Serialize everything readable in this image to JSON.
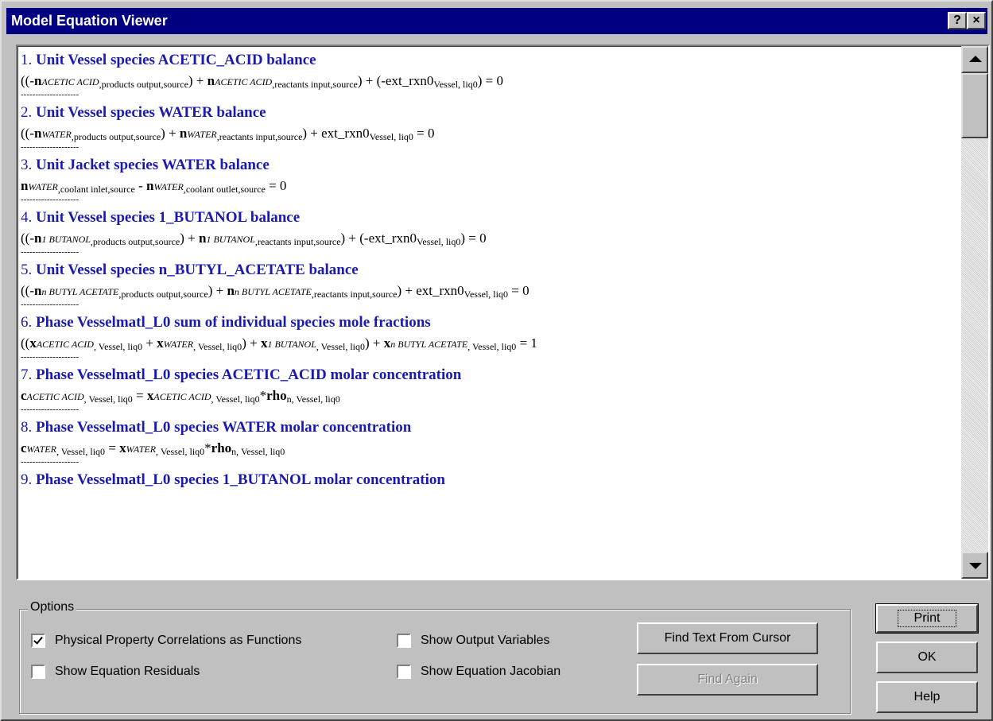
{
  "window": {
    "title": "Model Equation Viewer",
    "help_glyph": "?",
    "close_glyph": "×"
  },
  "equations": [
    {
      "num": "1.",
      "title": "Unit Vessel species ACETIC_ACID balance",
      "line": [
        {
          "t": "((-"
        },
        {
          "v": "n"
        },
        {
          "i": "ACETIC ACID"
        },
        {
          "s": ",products output,source"
        },
        {
          "t": ") + "
        },
        {
          "v": "n"
        },
        {
          "i": "ACETIC ACID"
        },
        {
          "s": ",reactants input,source"
        },
        {
          "t": ") + (-ext_rxn0"
        },
        {
          "s": "Vessel, liq0"
        },
        {
          "t": ") = 0"
        }
      ]
    },
    {
      "num": "2.",
      "title": "Unit Vessel species WATER balance",
      "line": [
        {
          "t": "((-"
        },
        {
          "v": "n"
        },
        {
          "i": "WATER"
        },
        {
          "s": ",products output,source"
        },
        {
          "t": ") + "
        },
        {
          "v": "n"
        },
        {
          "i": "WATER"
        },
        {
          "s": ",reactants input,source"
        },
        {
          "t": ") + ext_rxn0"
        },
        {
          "s": "Vessel, liq0"
        },
        {
          "t": " = 0"
        }
      ]
    },
    {
      "num": "3.",
      "title": "Unit Jacket species WATER balance",
      "line": [
        {
          "v": "n"
        },
        {
          "i": "WATER"
        },
        {
          "s": ",coolant inlet,source"
        },
        {
          "t": " - "
        },
        {
          "v": "n"
        },
        {
          "i": "WATER"
        },
        {
          "s": ",coolant outlet,source"
        },
        {
          "t": " = 0"
        }
      ]
    },
    {
      "num": "4.",
      "title": "Unit Vessel species 1_BUTANOL balance",
      "line": [
        {
          "t": "((-"
        },
        {
          "v": "n"
        },
        {
          "i": "1 BUTANOL"
        },
        {
          "s": ",products output,source"
        },
        {
          "t": ") + "
        },
        {
          "v": "n"
        },
        {
          "i": "1 BUTANOL"
        },
        {
          "s": ",reactants input,source"
        },
        {
          "t": ") + (-ext_rxn0"
        },
        {
          "s": "Vessel, liq0"
        },
        {
          "t": ") = 0"
        }
      ]
    },
    {
      "num": "5.",
      "title": "Unit Vessel species n_BUTYL_ACETATE balance",
      "line": [
        {
          "t": "((-"
        },
        {
          "v": "n"
        },
        {
          "i": "n BUTYL ACETATE"
        },
        {
          "s": ",products output,source"
        },
        {
          "t": ") + "
        },
        {
          "v": "n"
        },
        {
          "i": "n BUTYL ACETATE"
        },
        {
          "s": ",reactants input,source"
        },
        {
          "t": ") + ext_rxn0"
        },
        {
          "s": "Vessel, liq0"
        },
        {
          "t": " = 0"
        }
      ]
    },
    {
      "num": "6.",
      "title": "Phase Vesselmatl_L0 sum of individual species mole fractions",
      "line": [
        {
          "t": "(("
        },
        {
          "v": "x"
        },
        {
          "i": "ACETIC ACID"
        },
        {
          "s": ", Vessel, liq0"
        },
        {
          "t": " + "
        },
        {
          "v": "x"
        },
        {
          "i": "WATER"
        },
        {
          "s": ", Vessel, liq0"
        },
        {
          "t": ") + "
        },
        {
          "v": "x"
        },
        {
          "i": "1 BUTANOL"
        },
        {
          "s": ", Vessel, liq0"
        },
        {
          "t": ") + "
        },
        {
          "v": "x"
        },
        {
          "i": "n BUTYL ACETATE"
        },
        {
          "s": ", Vessel, liq0"
        },
        {
          "t": " = 1"
        }
      ]
    },
    {
      "num": "7.",
      "title": "Phase Vesselmatl_L0 species ACETIC_ACID molar concentration",
      "line": [
        {
          "v": "c"
        },
        {
          "i": "ACETIC ACID"
        },
        {
          "s": ", Vessel, liq0"
        },
        {
          "t": " = "
        },
        {
          "v": "x"
        },
        {
          "i": "ACETIC ACID"
        },
        {
          "s": ", Vessel, liq0"
        },
        {
          "t": "*"
        },
        {
          "v": "rho"
        },
        {
          "s": "n, Vessel, liq0"
        }
      ]
    },
    {
      "num": "8.",
      "title": "Phase Vesselmatl_L0 species WATER molar concentration",
      "line": [
        {
          "v": "c"
        },
        {
          "i": "WATER"
        },
        {
          "s": ", Vessel, liq0"
        },
        {
          "t": " = "
        },
        {
          "v": "x"
        },
        {
          "i": "WATER"
        },
        {
          "s": ", Vessel, liq0"
        },
        {
          "t": "*"
        },
        {
          "v": "rho"
        },
        {
          "s": "n, Vessel, liq0"
        }
      ]
    },
    {
      "num": "9.",
      "title": "Phase Vesselmatl_L0 species 1_BUTANOL molar concentration",
      "line": []
    }
  ],
  "separator": "--------------------",
  "options": {
    "legend": "Options",
    "physical_property": {
      "label": "Physical Property Correlations as Functions",
      "checked": true
    },
    "show_residuals": {
      "label": "Show Equation Residuals",
      "checked": false
    },
    "show_output_vars": {
      "label": "Show Output Variables",
      "checked": false
    },
    "show_jacobian": {
      "label": "Show Equation Jacobian",
      "checked": false
    }
  },
  "buttons": {
    "find_text": "Find Text From Cursor",
    "find_again": "Find Again",
    "print": "Print",
    "ok": "OK",
    "help": "Help"
  },
  "colors": {
    "title_bar": "#000080",
    "equation_title": "#1a1ab0",
    "face": "#c0c0c0"
  }
}
